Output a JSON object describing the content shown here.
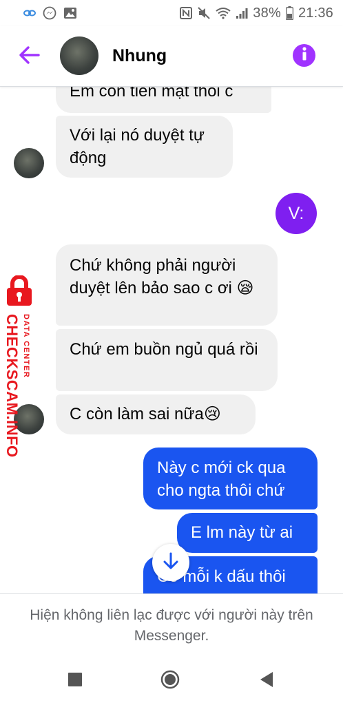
{
  "status_bar": {
    "battery": "38%",
    "time": "21:36"
  },
  "header": {
    "contact_name": "Nhung"
  },
  "messages": [
    {
      "direction": "incoming",
      "text": "Em còn tiền mặt thôi c"
    },
    {
      "direction": "incoming",
      "text": "Với lại nó duyệt tự động"
    },
    {
      "direction": "outgoing",
      "text": "V:"
    },
    {
      "direction": "incoming",
      "text": "Chứ không phải người duyệt lên bảo sao c ơi 😪"
    },
    {
      "direction": "incoming",
      "text": "Chứ em buồn ngủ quá rồi"
    },
    {
      "direction": "incoming",
      "text": "C còn làm sai nữa😢"
    },
    {
      "direction": "outgoing",
      "text": "Này c mới ck qua cho ngta thôi chứ"
    },
    {
      "direction": "outgoing",
      "text": "E lm này từ ai"
    },
    {
      "direction": "outgoing",
      "text": "Có mỗi k dấu thôi"
    }
  ],
  "watermark": {
    "brand": "CHECKSCAM.INFO",
    "subtitle": "DATA CENTER"
  },
  "footer": {
    "notice": "Hiện không liên lạc được với người này trên Messenger."
  },
  "colors": {
    "accent": "#a033ff",
    "outgoing_bubble": "#1a55f0",
    "incoming_bubble": "#f0f0f0",
    "watermark": "#e8181f"
  },
  "icons": {
    "back": "arrow-left-icon",
    "info": "info-icon",
    "scroll_down": "arrow-down-icon"
  }
}
